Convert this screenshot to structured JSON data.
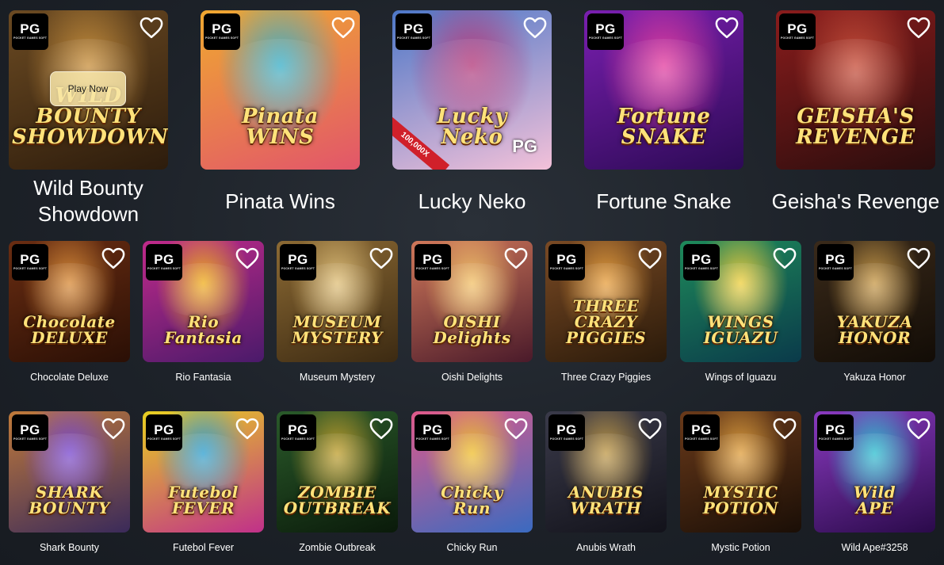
{
  "labels": {
    "pg": "PG",
    "pg_sub": "POCKET GAMES SOFT",
    "play_now": "Play Now"
  },
  "colors": {
    "background": "#1d2229",
    "heart_outline": "#ffffff",
    "badge_bg": "#000000",
    "play_button_bg": "#f8e6aa"
  },
  "featured_games": [
    {
      "title": "Wild Bounty Showdown",
      "art_text": "WILD BOUNTY\nSHOWDOWN",
      "colors": [
        "#6b4a22",
        "#2d1c0c",
        "#c9913f"
      ]
    },
    {
      "title": "Pinata Wins",
      "art_text": "Pinata\nWINS",
      "colors": [
        "#f0a830",
        "#e2566a",
        "#3bb0c9"
      ]
    },
    {
      "title": "Lucky Neko",
      "art_text": "Lucky\nNeko",
      "colors": [
        "#4d77c7",
        "#f3c1d9",
        "#b33a7a"
      ],
      "extra": "100,000X",
      "mark": "PG"
    },
    {
      "title": "Fortune Snake",
      "art_text": "Fortune\nSNAKE",
      "colors": [
        "#7a1fb0",
        "#2c0a55",
        "#e43fa0"
      ]
    },
    {
      "title": "Geisha's Revenge",
      "art_text": "GEISHA'S\nREVENGE",
      "colors": [
        "#8a1c1c",
        "#2a0d0d",
        "#c74e3a"
      ]
    }
  ],
  "games_row_2": [
    {
      "title": "Chocolate Deluxe",
      "art_text": "Chocolate\nDELUXE",
      "colors": [
        "#6a2d12",
        "#2a0f05",
        "#d98c3a"
      ]
    },
    {
      "title": "Rio Fantasia",
      "art_text": "Rio\nFantasia",
      "colors": [
        "#c02a8a",
        "#4a1a6a",
        "#f0b020"
      ]
    },
    {
      "title": "Museum Mystery",
      "art_text": "MUSEUM\nMYSTERY",
      "colors": [
        "#8c6a34",
        "#3c2a12",
        "#e0c07a"
      ]
    },
    {
      "title": "Oishi Delights",
      "art_text": "OISHI\nDelights",
      "colors": [
        "#d0785a",
        "#4a1a2a",
        "#f2c26a"
      ]
    },
    {
      "title": "Three Crazy Piggies",
      "art_text": "THREE\nCRAZY\nPIGGIES",
      "colors": [
        "#7a4a24",
        "#2a1a0a",
        "#e8a040"
      ]
    },
    {
      "title": "Wings of Iguazu",
      "art_text": "WINGS\nIGUAZU",
      "colors": [
        "#1e8a5a",
        "#0a3a4a",
        "#f0d040"
      ]
    },
    {
      "title": "Yakuza Honor",
      "art_text": "YAKUZA\nHONOR",
      "colors": [
        "#3a2a1a",
        "#120c06",
        "#c89a4a"
      ]
    }
  ],
  "games_row_3": [
    {
      "title": "Shark Bounty",
      "art_text": "SHARK\nBOUNTY",
      "colors": [
        "#c07a3a",
        "#3a2a5a",
        "#7a4ad0"
      ]
    },
    {
      "title": "Futebol Fever",
      "art_text": "Futebol\nFEVER",
      "colors": [
        "#e8d020",
        "#c0308a",
        "#30a0d0"
      ]
    },
    {
      "title": "Zombie Outbreak",
      "art_text": "ZOMBIE\nOUTBREAK",
      "colors": [
        "#2a5a2a",
        "#0a1a0a",
        "#c0a030"
      ]
    },
    {
      "title": "Chicky Run",
      "art_text": "Chicky\nRun",
      "colors": [
        "#e05a8a",
        "#3a6ac0",
        "#f0c030"
      ]
    },
    {
      "title": "Anubis Wrath",
      "art_text": "ANUBIS\nWRATH",
      "colors": [
        "#3a3a4a",
        "#12121a",
        "#c09a4a"
      ]
    },
    {
      "title": "Mystic Potion",
      "art_text": "MYSTIC\nPOTION",
      "colors": [
        "#6a3a1a",
        "#1a0e06",
        "#e0a040"
      ]
    },
    {
      "title": "Wild Ape#3258",
      "art_text": "Wild\nAPE",
      "colors": [
        "#8a3ac0",
        "#2a0a4a",
        "#30c0d0"
      ]
    }
  ]
}
